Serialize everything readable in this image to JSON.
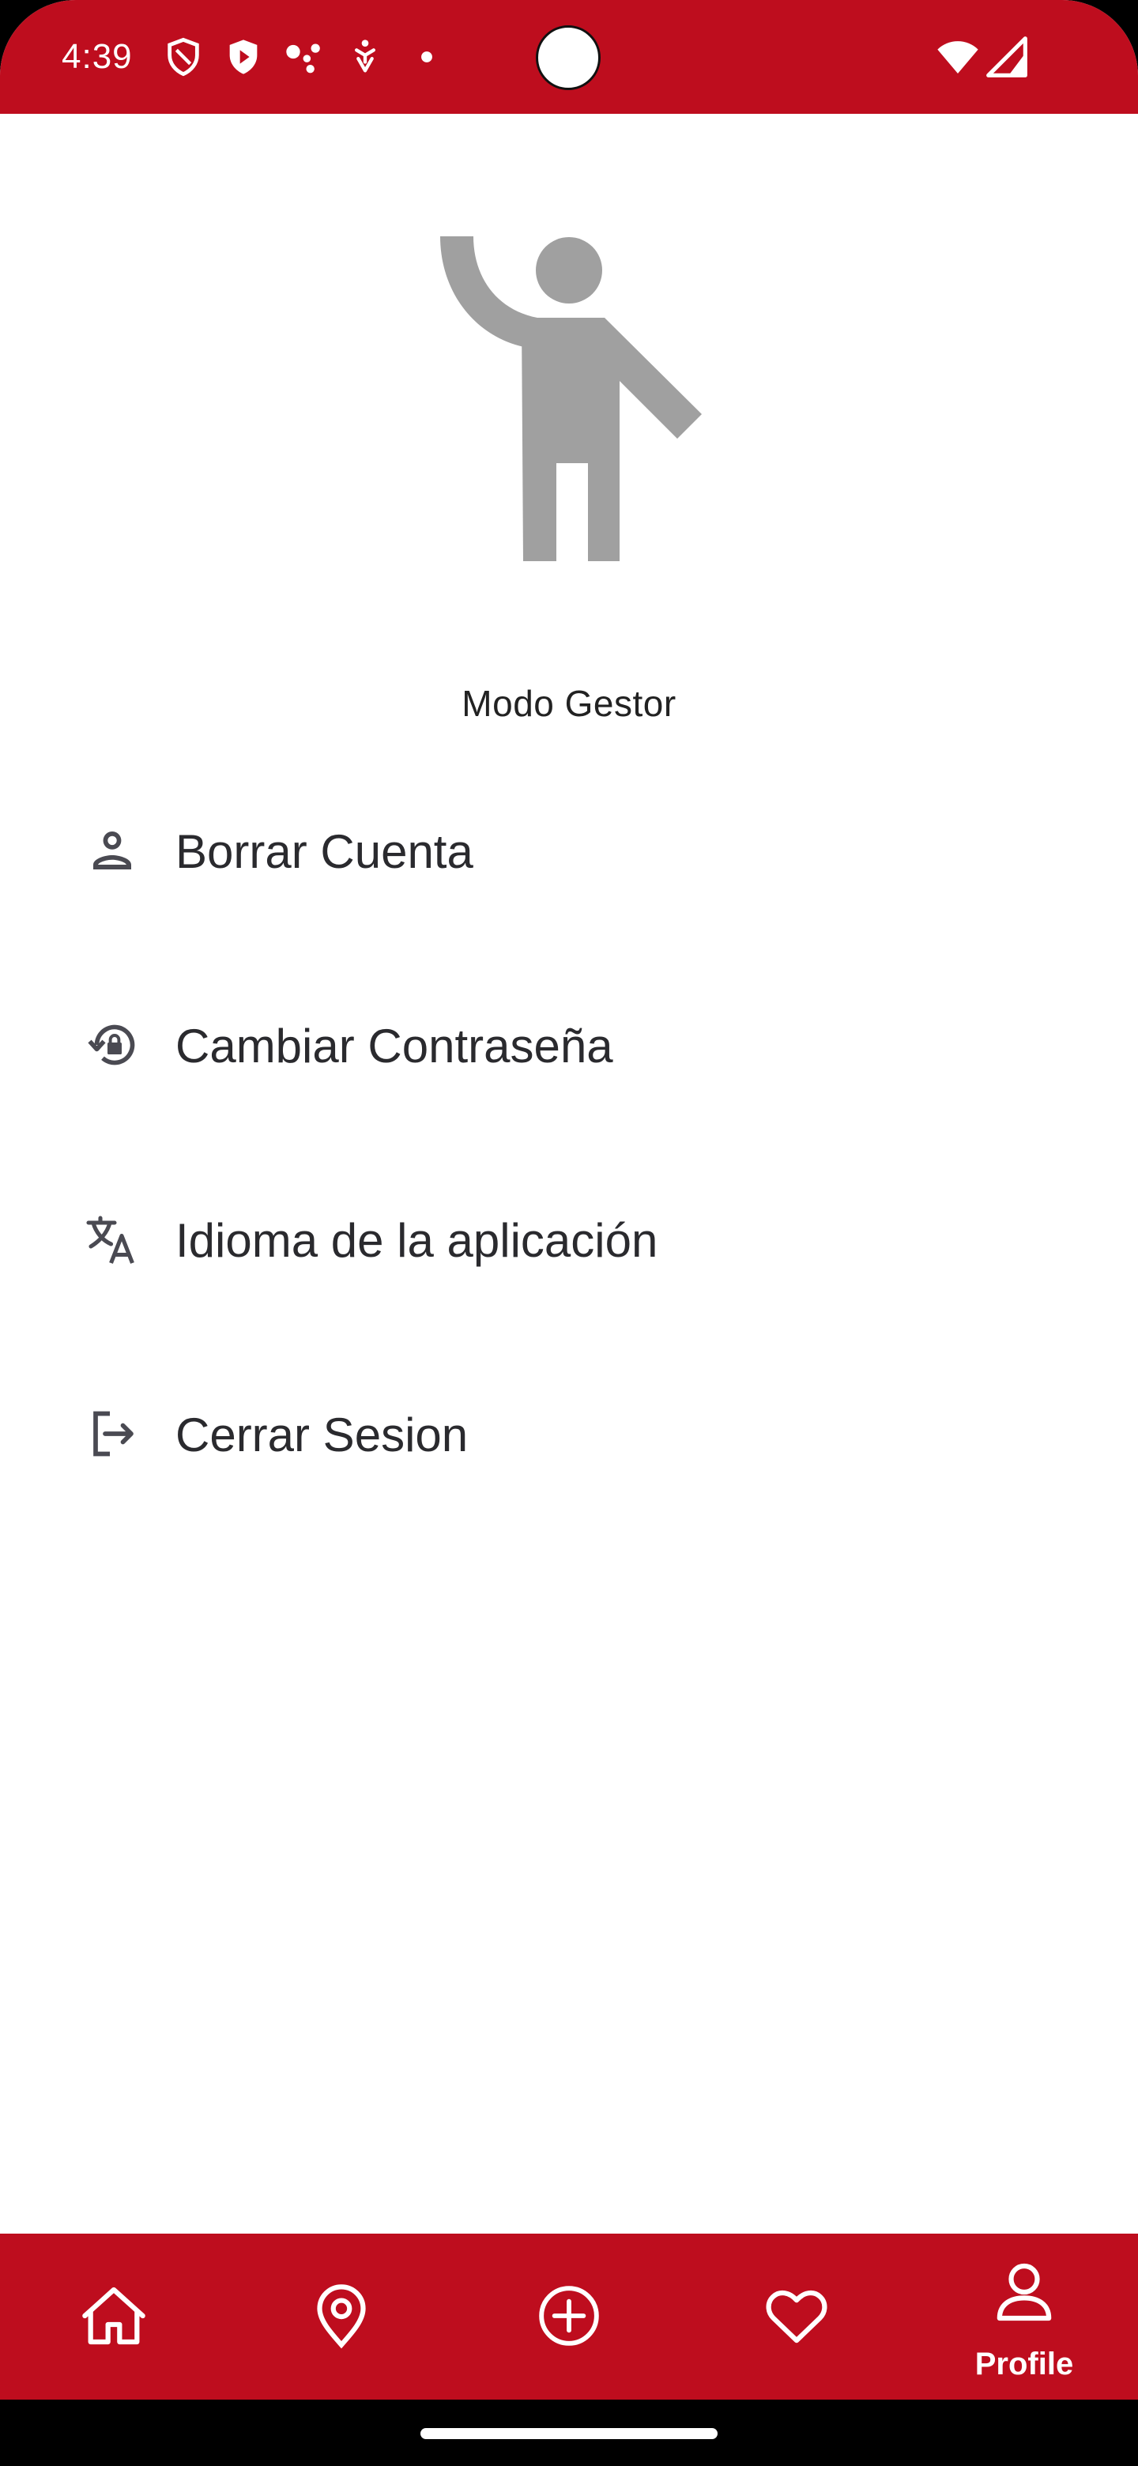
{
  "status_bar": {
    "time": "4:39",
    "icons": [
      "shield-icon",
      "play-shield-icon",
      "assistant-dots-icon",
      "accessibility-icon",
      "notification-dot-icon",
      "wifi-icon",
      "cell-signal-icon"
    ]
  },
  "profile": {
    "avatar_icon": "waving-person-icon",
    "mode_label": "Modo Gestor"
  },
  "menu": {
    "items": [
      {
        "icon": "person-outline-icon",
        "label": "Borrar Cuenta"
      },
      {
        "icon": "lock-reset-icon",
        "label": "Cambiar Contraseña"
      },
      {
        "icon": "translate-icon",
        "label": "Idioma de la aplicación"
      },
      {
        "icon": "logout-icon",
        "label": "Cerrar Sesion"
      }
    ]
  },
  "bottom_nav": {
    "items": [
      {
        "icon": "home-icon",
        "label": ""
      },
      {
        "icon": "location-pin-icon",
        "label": ""
      },
      {
        "icon": "add-circle-icon",
        "label": ""
      },
      {
        "icon": "heart-icon",
        "label": ""
      },
      {
        "icon": "person-icon",
        "label": "Profile",
        "selected": true
      }
    ]
  },
  "colors": {
    "brand_red": "#be0d1e",
    "avatar_gray": "#a0a0a0",
    "text_dark": "#2a2a2e",
    "icon_dark": "#4a4a52"
  }
}
